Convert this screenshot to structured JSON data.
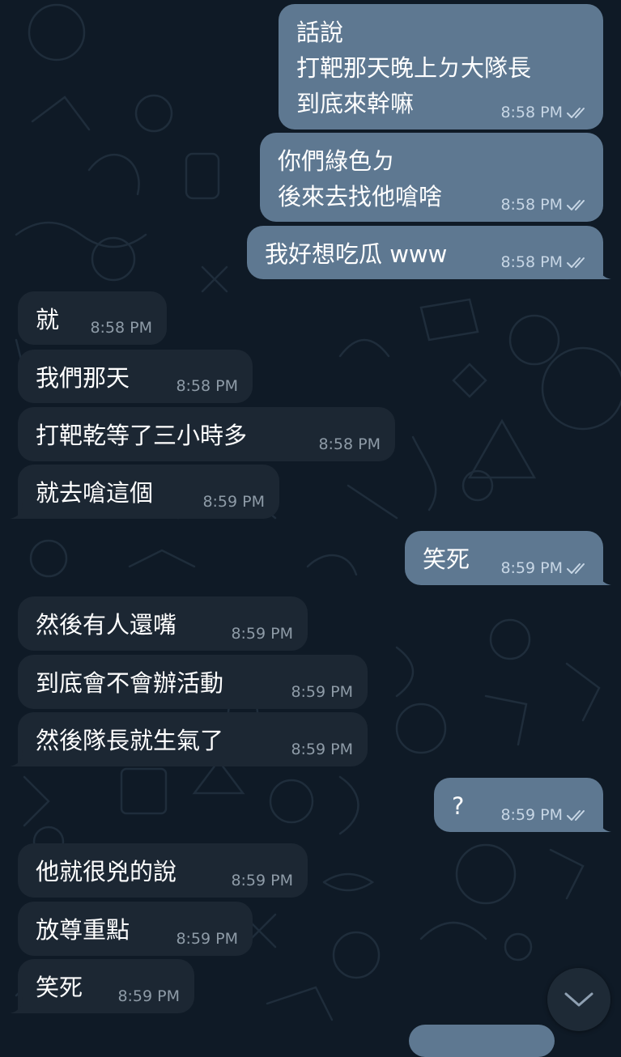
{
  "messages": [
    {
      "dir": "out",
      "text": "話說\n打靶那天晚上ㄉ大隊長\n到底來幹嘛",
      "time": "8:58 PM"
    },
    {
      "dir": "out",
      "text": "你們綠色ㄉ\n後來去找他嗆啥",
      "time": "8:58 PM"
    },
    {
      "dir": "out",
      "text": "我好想吃瓜 www",
      "time": "8:58 PM"
    },
    {
      "dir": "in",
      "text": "就",
      "time": "8:58 PM"
    },
    {
      "dir": "in",
      "text": "我們那天",
      "time": "8:58 PM"
    },
    {
      "dir": "in",
      "text": "打靶乾等了三小時多",
      "time": "8:58 PM"
    },
    {
      "dir": "in",
      "text": "就去嗆這個",
      "time": "8:59 PM"
    },
    {
      "dir": "out",
      "text": "笑死",
      "time": "8:59 PM"
    },
    {
      "dir": "in",
      "text": "然後有人還嘴",
      "time": "8:59 PM"
    },
    {
      "dir": "in",
      "text": "到底會不會辦活動",
      "time": "8:59 PM"
    },
    {
      "dir": "in",
      "text": "然後隊長就生氣了",
      "time": "8:59 PM"
    },
    {
      "dir": "out",
      "text": "?",
      "time": "8:59 PM"
    },
    {
      "dir": "in",
      "text": "他就很兇的說",
      "time": "8:59 PM"
    },
    {
      "dir": "in",
      "text": "放尊重點",
      "time": "8:59 PM"
    },
    {
      "dir": "in",
      "text": "笑死",
      "time": "8:59 PM"
    }
  ],
  "colors": {
    "background": "#0f1a26",
    "incoming_bubble": "#1c2733",
    "outgoing_bubble": "#5e7891"
  },
  "icons": {
    "read_receipt": "double-check-icon",
    "scroll_down": "chevron-down-icon"
  }
}
